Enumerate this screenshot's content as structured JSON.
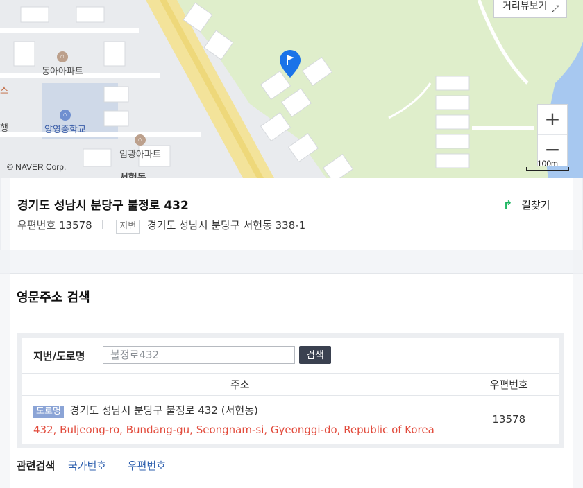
{
  "map": {
    "copyright": "© NAVER Corp.",
    "streetview_label": "거리뷰보기",
    "scale_label": "100m",
    "zoom_in": "+",
    "zoom_out": "−",
    "labels": {
      "dongah": "동아아파트",
      "yangyoung": "양영중학교",
      "imgwang": "임광아파트",
      "seohyeon": "서현동",
      "edge_s": "스",
      "edge_h": "행"
    },
    "colors": {
      "park": "#dfeecb",
      "road_main": "#f3e39a",
      "block": "#ffffff",
      "water": "#a7c8f0",
      "pin": "#1a73e8"
    }
  },
  "address": {
    "title": "경기도 성남시 분당구 불정로 432",
    "zip_label": "우편번호",
    "zip_value": "13578",
    "jibun_tag": "지번",
    "jibun_value": "경기도 성남시 분당구 서현동 338-1",
    "route_label": "길찾기"
  },
  "english": {
    "section_title": "영문주소 검색",
    "search_label": "지번/도로명",
    "search_placeholder": "불정로432",
    "search_button": "검색",
    "columns": {
      "address": "주소",
      "zip": "우편번호"
    },
    "result": {
      "road_tag": "도로명",
      "korean": "경기도 성남시 분당구 불정로 432 (서현동)",
      "english": "432, Buljeong-ro, Bundang-gu, Seongnam-si, Gyeonggi-do, Republic of Korea",
      "zip": "13578"
    },
    "related_label": "관련검색",
    "related_links": [
      "국가번호",
      "우편번호"
    ]
  }
}
